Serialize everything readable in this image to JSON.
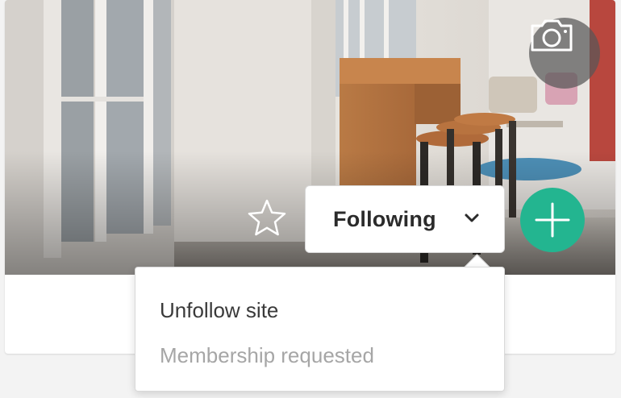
{
  "hero": {
    "image": "office-interior-photo"
  },
  "icons": {
    "camera": "camera-icon",
    "star": "star-icon",
    "chevron": "chevron-down-icon",
    "add": "plus-icon"
  },
  "follow": {
    "label": "Following"
  },
  "dropdown": {
    "items": [
      {
        "label": "Unfollow site"
      },
      {
        "label": "Membership requested"
      }
    ]
  },
  "colors": {
    "accent_green": "#23b590",
    "muted_text": "#a6a6a6",
    "primary_text": "#2b2b2b"
  }
}
